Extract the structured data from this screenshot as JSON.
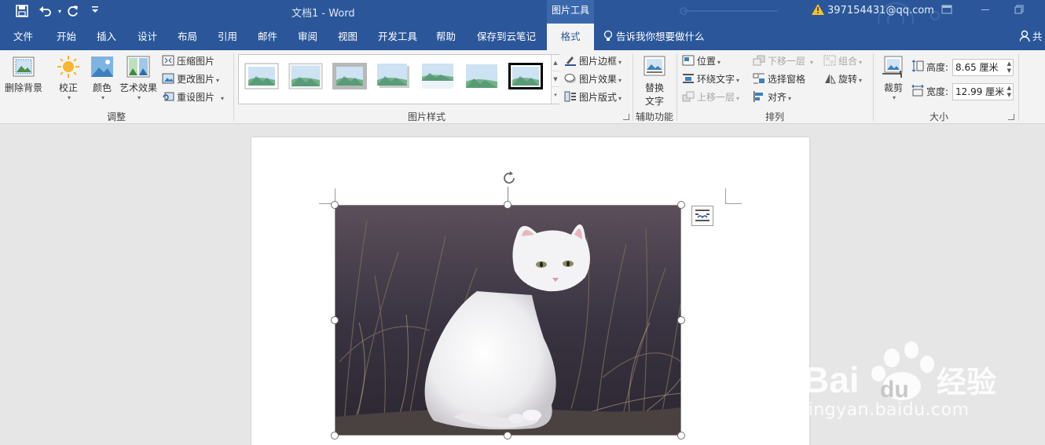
{
  "titlebar": {
    "title": "文档1  -  Word",
    "context_tab_header": "图片工具",
    "account": "397154431@qq.com"
  },
  "tabs": [
    "文件",
    "开始",
    "插入",
    "设计",
    "布局",
    "引用",
    "邮件",
    "审阅",
    "视图",
    "开发工具",
    "帮助",
    "保存到云笔记",
    "格式"
  ],
  "active_tab": "格式",
  "tell_me": "告诉我你想要做什么",
  "share": "共",
  "ribbon": {
    "adjust": {
      "remove_bg": "删除背景",
      "corrections": "校正",
      "color": "颜色",
      "artistic": "艺术效果",
      "compress": "压缩图片",
      "change": "更改图片",
      "reset": "重设图片",
      "label": "调整"
    },
    "styles": {
      "border": "图片边框",
      "effects": "图片效果",
      "layout": "图片版式",
      "label": "图片样式"
    },
    "accessibility": {
      "alt_text_line1": "替换",
      "alt_text_line2": "文字",
      "label": "辅助功能"
    },
    "arrange": {
      "position": "位置",
      "wrap": "环绕文字",
      "bring_forward": "上移一层",
      "send_backward": "下移一层",
      "selection_pane": "选择窗格",
      "align": "对齐",
      "group": "组合",
      "rotate": "旋转",
      "label": "排列"
    },
    "size": {
      "crop": "裁剪",
      "height_label": "高度:",
      "height_value": "8.65 厘米",
      "width_label": "宽度:",
      "width_value": "12.99 厘米",
      "label": "大小"
    }
  },
  "watermark": {
    "url": "jingyan.baidu.com"
  },
  "colors": {
    "accent": "#2b579a",
    "ribbon_bg": "#f3f3f3",
    "canvas_bg": "#e6e6e6"
  }
}
